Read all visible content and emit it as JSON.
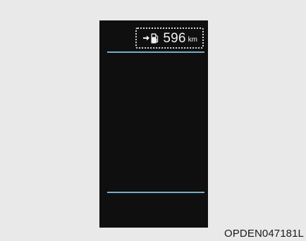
{
  "display": {
    "range": {
      "icons": [
        "arrow-right-icon",
        "fuel-pump-icon"
      ],
      "value": "596",
      "unit": "km"
    },
    "colors": {
      "screen": "#0f0f0f",
      "divider": "#7fbfe0",
      "text": "#f2f2f2",
      "background": "#e9e9e9"
    }
  },
  "caption": "OPDEN047181L"
}
